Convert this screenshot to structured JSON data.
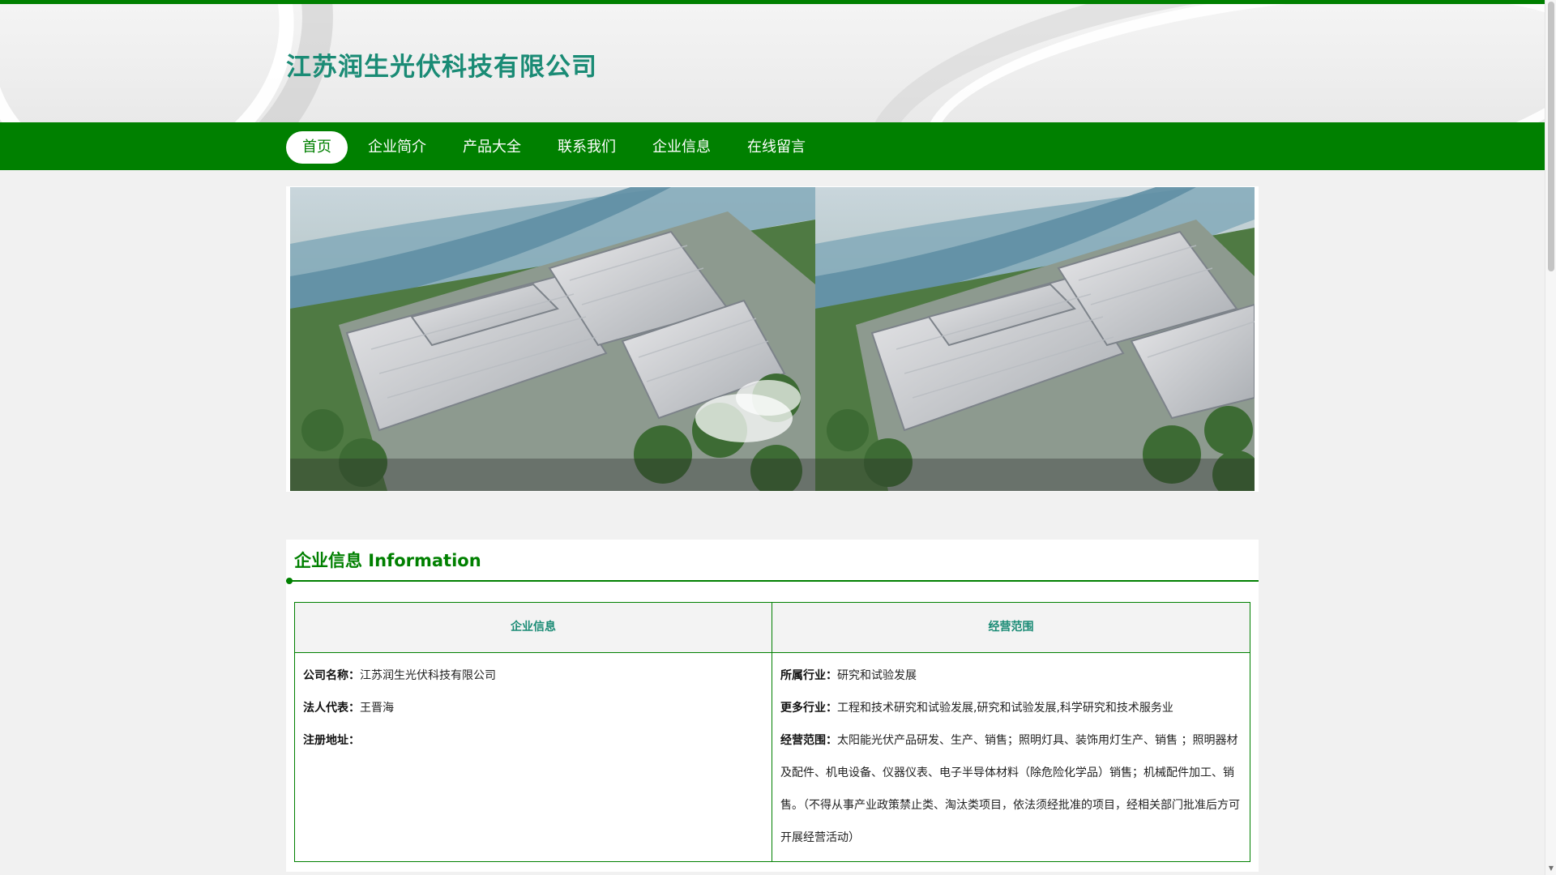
{
  "header": {
    "site_title": "江苏润生光伏科技有限公司"
  },
  "nav": {
    "items": [
      {
        "label": "首页",
        "active": true
      },
      {
        "label": "企业简介"
      },
      {
        "label": "产品大全"
      },
      {
        "label": "联系我们"
      },
      {
        "label": "企业信息"
      },
      {
        "label": "在线留言"
      }
    ]
  },
  "info": {
    "heading": "企业信息 Information",
    "left_header": "企业信息",
    "right_header": "经营范围",
    "left_fields": [
      {
        "label": "公司名称：",
        "value": "江苏润生光伏科技有限公司"
      },
      {
        "label": "法人代表：",
        "value": "王晋海"
      },
      {
        "label": "注册地址：",
        "value": ""
      }
    ],
    "right_fields": [
      {
        "label": "所属行业：",
        "value": "研究和试验发展"
      },
      {
        "label": "更多行业：",
        "value": "工程和技术研究和试验发展,研究和试验发展,科学研究和技术服务业"
      },
      {
        "label": "经营范围：",
        "value": "太阳能光伏产品研发、生产、销售；照明灯具、装饰用灯生产、销售 ；照明器材及配件、机电设备、仪器仪表、电子半导体材料（除危险化学品）销售；机械配件加工、销售。（不得从事产业政策禁止类、淘汰类项目，依法须经批准的项目，经相关部门批准后方可开展经营活动）"
      }
    ]
  },
  "colors": {
    "brand_green": "#008000",
    "title_teal": "#1a8b75"
  },
  "icons": {
    "scroll_up": "▲",
    "scroll_down": "▼"
  }
}
